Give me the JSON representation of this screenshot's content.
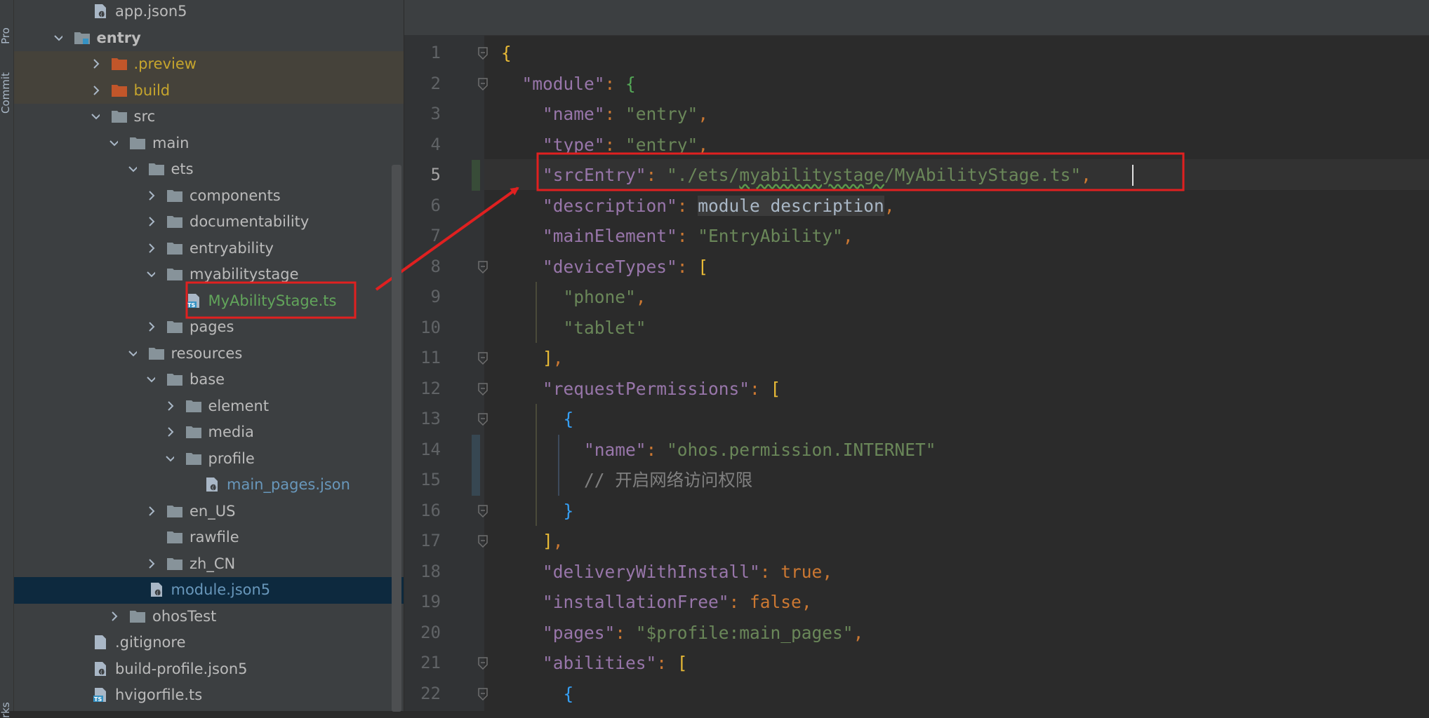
{
  "side_strip": {
    "labels": [
      "Pro",
      "Commit",
      "rks"
    ]
  },
  "project_tree": {
    "rows": [
      {
        "depth": 0,
        "kind": "json5",
        "label": "app.json5",
        "color": "#bbbbbb"
      },
      {
        "depth": -1,
        "kind": "module",
        "label": "entry",
        "expanded": true,
        "bold": true,
        "color": "#bbbbbb"
      },
      {
        "depth": 1,
        "kind": "folder-orange",
        "label": ".preview",
        "expanded": false,
        "color": "#c6a52d"
      },
      {
        "depth": 1,
        "kind": "folder-orange",
        "label": "build",
        "expanded": false,
        "color": "#c6a52d"
      },
      {
        "depth": 1,
        "kind": "folder",
        "label": "src",
        "expanded": true,
        "color": "#bbbbbb"
      },
      {
        "depth": 2,
        "kind": "folder",
        "label": "main",
        "expanded": true,
        "color": "#bbbbbb"
      },
      {
        "depth": 3,
        "kind": "folder",
        "label": "ets",
        "expanded": true,
        "color": "#bbbbbb"
      },
      {
        "depth": 4,
        "kind": "folder",
        "label": "components",
        "expanded": false,
        "color": "#bbbbbb"
      },
      {
        "depth": 4,
        "kind": "folder",
        "label": "documentability",
        "expanded": false,
        "color": "#bbbbbb"
      },
      {
        "depth": 4,
        "kind": "folder",
        "label": "entryability",
        "expanded": false,
        "color": "#bbbbbb"
      },
      {
        "depth": 4,
        "kind": "folder",
        "label": "myabilitystage",
        "expanded": true,
        "color": "#bbbbbb"
      },
      {
        "depth": 5,
        "kind": "ts",
        "label": "MyAbilityStage.ts",
        "color": "#62a55b"
      },
      {
        "depth": 4,
        "kind": "folder",
        "label": "pages",
        "expanded": false,
        "color": "#bbbbbb"
      },
      {
        "depth": 3,
        "kind": "folder",
        "label": "resources",
        "expanded": true,
        "color": "#bbbbbb"
      },
      {
        "depth": 4,
        "kind": "folder",
        "label": "base",
        "expanded": true,
        "color": "#bbbbbb"
      },
      {
        "depth": 5,
        "kind": "folder",
        "label": "element",
        "expanded": false,
        "color": "#bbbbbb"
      },
      {
        "depth": 5,
        "kind": "folder",
        "label": "media",
        "expanded": false,
        "color": "#bbbbbb"
      },
      {
        "depth": 5,
        "kind": "folder",
        "label": "profile",
        "expanded": true,
        "color": "#bbbbbb"
      },
      {
        "depth": 6,
        "kind": "json5",
        "label": "main_pages.json",
        "color": "#6897bb"
      },
      {
        "depth": 4,
        "kind": "folder",
        "label": "en_US",
        "expanded": false,
        "color": "#bbbbbb"
      },
      {
        "depth": 4,
        "kind": "folder",
        "label": "rawfile",
        "color": "#bbbbbb"
      },
      {
        "depth": 4,
        "kind": "folder",
        "label": "zh_CN",
        "expanded": false,
        "color": "#bbbbbb"
      },
      {
        "depth": 3,
        "kind": "json5",
        "label": "module.json5",
        "selected": true,
        "color": "#6897bb"
      },
      {
        "depth": 2,
        "kind": "folder",
        "label": "ohosTest",
        "expanded": false,
        "color": "#bbbbbb"
      },
      {
        "depth": 0,
        "kind": "file",
        "label": ".gitignore",
        "color": "#bbbbbb"
      },
      {
        "depth": 0,
        "kind": "json5",
        "label": "build-profile.json5",
        "color": "#bbbbbb"
      },
      {
        "depth": 0,
        "kind": "ts",
        "label": "hvigorfile.ts",
        "color": "#bbbbbb"
      }
    ]
  },
  "editor": {
    "current_line": 5,
    "lines": [
      {
        "n": 1,
        "fold": true,
        "tokens": [
          [
            "{",
            "by"
          ]
        ]
      },
      {
        "n": 2,
        "fold": true,
        "tokens": [
          [
            "  ",
            "p"
          ],
          [
            "\"module\"",
            "k"
          ],
          [
            ": ",
            "b"
          ],
          [
            "{",
            "bg"
          ]
        ]
      },
      {
        "n": 3,
        "tokens": [
          [
            "    ",
            "p"
          ],
          [
            "\"name\"",
            "k"
          ],
          [
            ": ",
            "b"
          ],
          [
            "\"entry\"",
            "s"
          ],
          [
            ",",
            "b"
          ]
        ]
      },
      {
        "n": 4,
        "tokens": [
          [
            "    ",
            "p"
          ],
          [
            "\"type\"",
            "k"
          ],
          [
            ": ",
            "b"
          ],
          [
            "\"entry\"",
            "s"
          ],
          [
            ",",
            "b"
          ]
        ]
      },
      {
        "n": 5,
        "tokens": [
          [
            "    ",
            "p"
          ],
          [
            "\"srcEntry\"",
            "k"
          ],
          [
            ": ",
            "b"
          ],
          [
            "\"./ets/",
            "s"
          ],
          [
            "myabilitystage",
            "s squig"
          ],
          [
            "/MyAbilityStage.ts\"",
            "s"
          ],
          [
            ",",
            "b"
          ]
        ]
      },
      {
        "n": 6,
        "tokens": [
          [
            "    ",
            "p"
          ],
          [
            "\"description\"",
            "k"
          ],
          [
            ": ",
            "b"
          ],
          [
            "module description",
            "p hlbg"
          ],
          [
            ",",
            "b"
          ]
        ]
      },
      {
        "n": 7,
        "tokens": [
          [
            "    ",
            "p"
          ],
          [
            "\"mainElement\"",
            "k"
          ],
          [
            ": ",
            "b"
          ],
          [
            "\"EntryAbility\"",
            "s"
          ],
          [
            ",",
            "b"
          ]
        ]
      },
      {
        "n": 8,
        "fold": true,
        "tokens": [
          [
            "    ",
            "p"
          ],
          [
            "\"deviceTypes\"",
            "k"
          ],
          [
            ": ",
            "b"
          ],
          [
            "[",
            "by"
          ]
        ]
      },
      {
        "n": 9,
        "tokens": [
          [
            "      ",
            "p"
          ],
          [
            "\"phone\"",
            "s"
          ],
          [
            ",",
            "b"
          ]
        ]
      },
      {
        "n": 10,
        "tokens": [
          [
            "      ",
            "p"
          ],
          [
            "\"tablet\"",
            "s"
          ]
        ]
      },
      {
        "n": 11,
        "fold": true,
        "tokens": [
          [
            "    ",
            "p"
          ],
          [
            "]",
            "by"
          ],
          [
            ",",
            "b"
          ]
        ]
      },
      {
        "n": 12,
        "fold": true,
        "tokens": [
          [
            "    ",
            "p"
          ],
          [
            "\"requestPermissions\"",
            "k"
          ],
          [
            ": ",
            "b"
          ],
          [
            "[",
            "by"
          ]
        ]
      },
      {
        "n": 13,
        "fold": true,
        "tokens": [
          [
            "      ",
            "p"
          ],
          [
            "{",
            "bb"
          ]
        ]
      },
      {
        "n": 14,
        "tokens": [
          [
            "        ",
            "p"
          ],
          [
            "\"name\"",
            "k"
          ],
          [
            ": ",
            "b"
          ],
          [
            "\"ohos.permission.INTERNET\"",
            "s"
          ]
        ]
      },
      {
        "n": 15,
        "tokens": [
          [
            "        ",
            "p"
          ],
          [
            "// 开启网络访问权限",
            "cm"
          ]
        ]
      },
      {
        "n": 16,
        "fold": true,
        "tokens": [
          [
            "      ",
            "p"
          ],
          [
            "}",
            "bb"
          ]
        ]
      },
      {
        "n": 17,
        "fold": true,
        "tokens": [
          [
            "    ",
            "p"
          ],
          [
            "]",
            "by"
          ],
          [
            ",",
            "b"
          ]
        ]
      },
      {
        "n": 18,
        "tokens": [
          [
            "    ",
            "p"
          ],
          [
            "\"deliveryWithInstall\"",
            "k"
          ],
          [
            ": ",
            "b"
          ],
          [
            "true",
            "kw"
          ],
          [
            ",",
            "b"
          ]
        ]
      },
      {
        "n": 19,
        "tokens": [
          [
            "    ",
            "p"
          ],
          [
            "\"installationFree\"",
            "k"
          ],
          [
            ": ",
            "b"
          ],
          [
            "false",
            "kw"
          ],
          [
            ",",
            "b"
          ]
        ]
      },
      {
        "n": 20,
        "tokens": [
          [
            "    ",
            "p"
          ],
          [
            "\"pages\"",
            "k"
          ],
          [
            ": ",
            "b"
          ],
          [
            "\"$profile:main_pages\"",
            "s"
          ],
          [
            ",",
            "b"
          ]
        ]
      },
      {
        "n": 21,
        "fold": true,
        "tokens": [
          [
            "    ",
            "p"
          ],
          [
            "\"abilities\"",
            "k"
          ],
          [
            ": ",
            "b"
          ],
          [
            "[",
            "by"
          ]
        ]
      },
      {
        "n": 22,
        "fold": true,
        "tokens": [
          [
            "      ",
            "p"
          ],
          [
            "{",
            "bb"
          ]
        ]
      }
    ]
  },
  "colors": {
    "annotation_red": "#e02020",
    "tree_bg": "#3c3f41",
    "editor_bg": "#2b2b2b",
    "selection": "#0d293e"
  }
}
